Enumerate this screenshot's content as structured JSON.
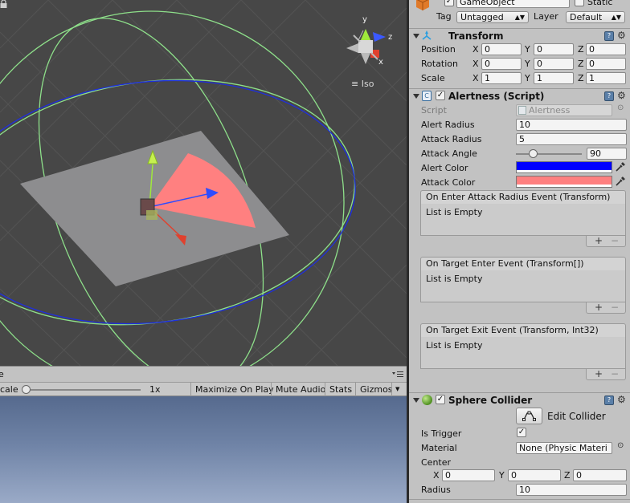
{
  "scene": {
    "gizmo_axes": {
      "y": "y",
      "z": "z",
      "x": "x"
    },
    "projection_label": "Iso"
  },
  "game": {
    "tab_title": "e",
    "scale_label": "cale",
    "scale_value": "1x",
    "scale_fraction": 0.0,
    "buttons": [
      "Maximize On Play",
      "Mute Audio",
      "Stats",
      "Gizmos"
    ]
  },
  "inspector": {
    "gameobject": {
      "name": "GameObject",
      "static_label": "Static",
      "tag_label": "Tag",
      "tag_value": "Untagged",
      "layer_label": "Layer",
      "layer_value": "Default"
    },
    "transform": {
      "title": "Transform",
      "rows": [
        {
          "label": "Position",
          "x": "0",
          "y": "0",
          "z": "0"
        },
        {
          "label": "Rotation",
          "x": "0",
          "y": "0",
          "z": "0"
        },
        {
          "label": "Scale",
          "x": "1",
          "y": "1",
          "z": "1"
        }
      ],
      "axis_x": "X",
      "axis_y": "Y",
      "axis_z": "Z"
    },
    "alertness": {
      "title": "Alertness (Script)",
      "script_label": "Script",
      "script_value": "Alertness",
      "alert_radius_label": "Alert Radius",
      "alert_radius_value": "10",
      "attack_radius_label": "Attack Radius",
      "attack_radius_value": "5",
      "attack_angle_label": "Attack Angle",
      "attack_angle_value": "90",
      "attack_angle_slider_fraction": 0.25,
      "alert_color_label": "Alert Color",
      "alert_color": "#0000ff",
      "attack_color_label": "Attack Color",
      "attack_color": "#ff8080",
      "events": [
        {
          "title": "On Enter Attack Radius Event (Transform)",
          "body": "List is Empty"
        },
        {
          "title": "On Target Enter Event (Transform[])",
          "body": "List is Empty"
        },
        {
          "title": "On Target Exit Event (Transform, Int32)",
          "body": "List is Empty"
        }
      ],
      "add_label": "+",
      "remove_label": "−"
    },
    "sphere_collider": {
      "title": "Sphere Collider",
      "edit_collider_label": "Edit Collider",
      "is_trigger_label": "Is Trigger",
      "material_label": "Material",
      "material_value": "None (Physic Materi",
      "center_label": "Center",
      "center": {
        "x": "0",
        "y": "0",
        "z": "0"
      },
      "radius_label": "Radius",
      "radius_value": "10"
    },
    "icons": {
      "help": "help-icon",
      "gear": "gear-icon",
      "picker": "eyedropper-icon"
    }
  }
}
